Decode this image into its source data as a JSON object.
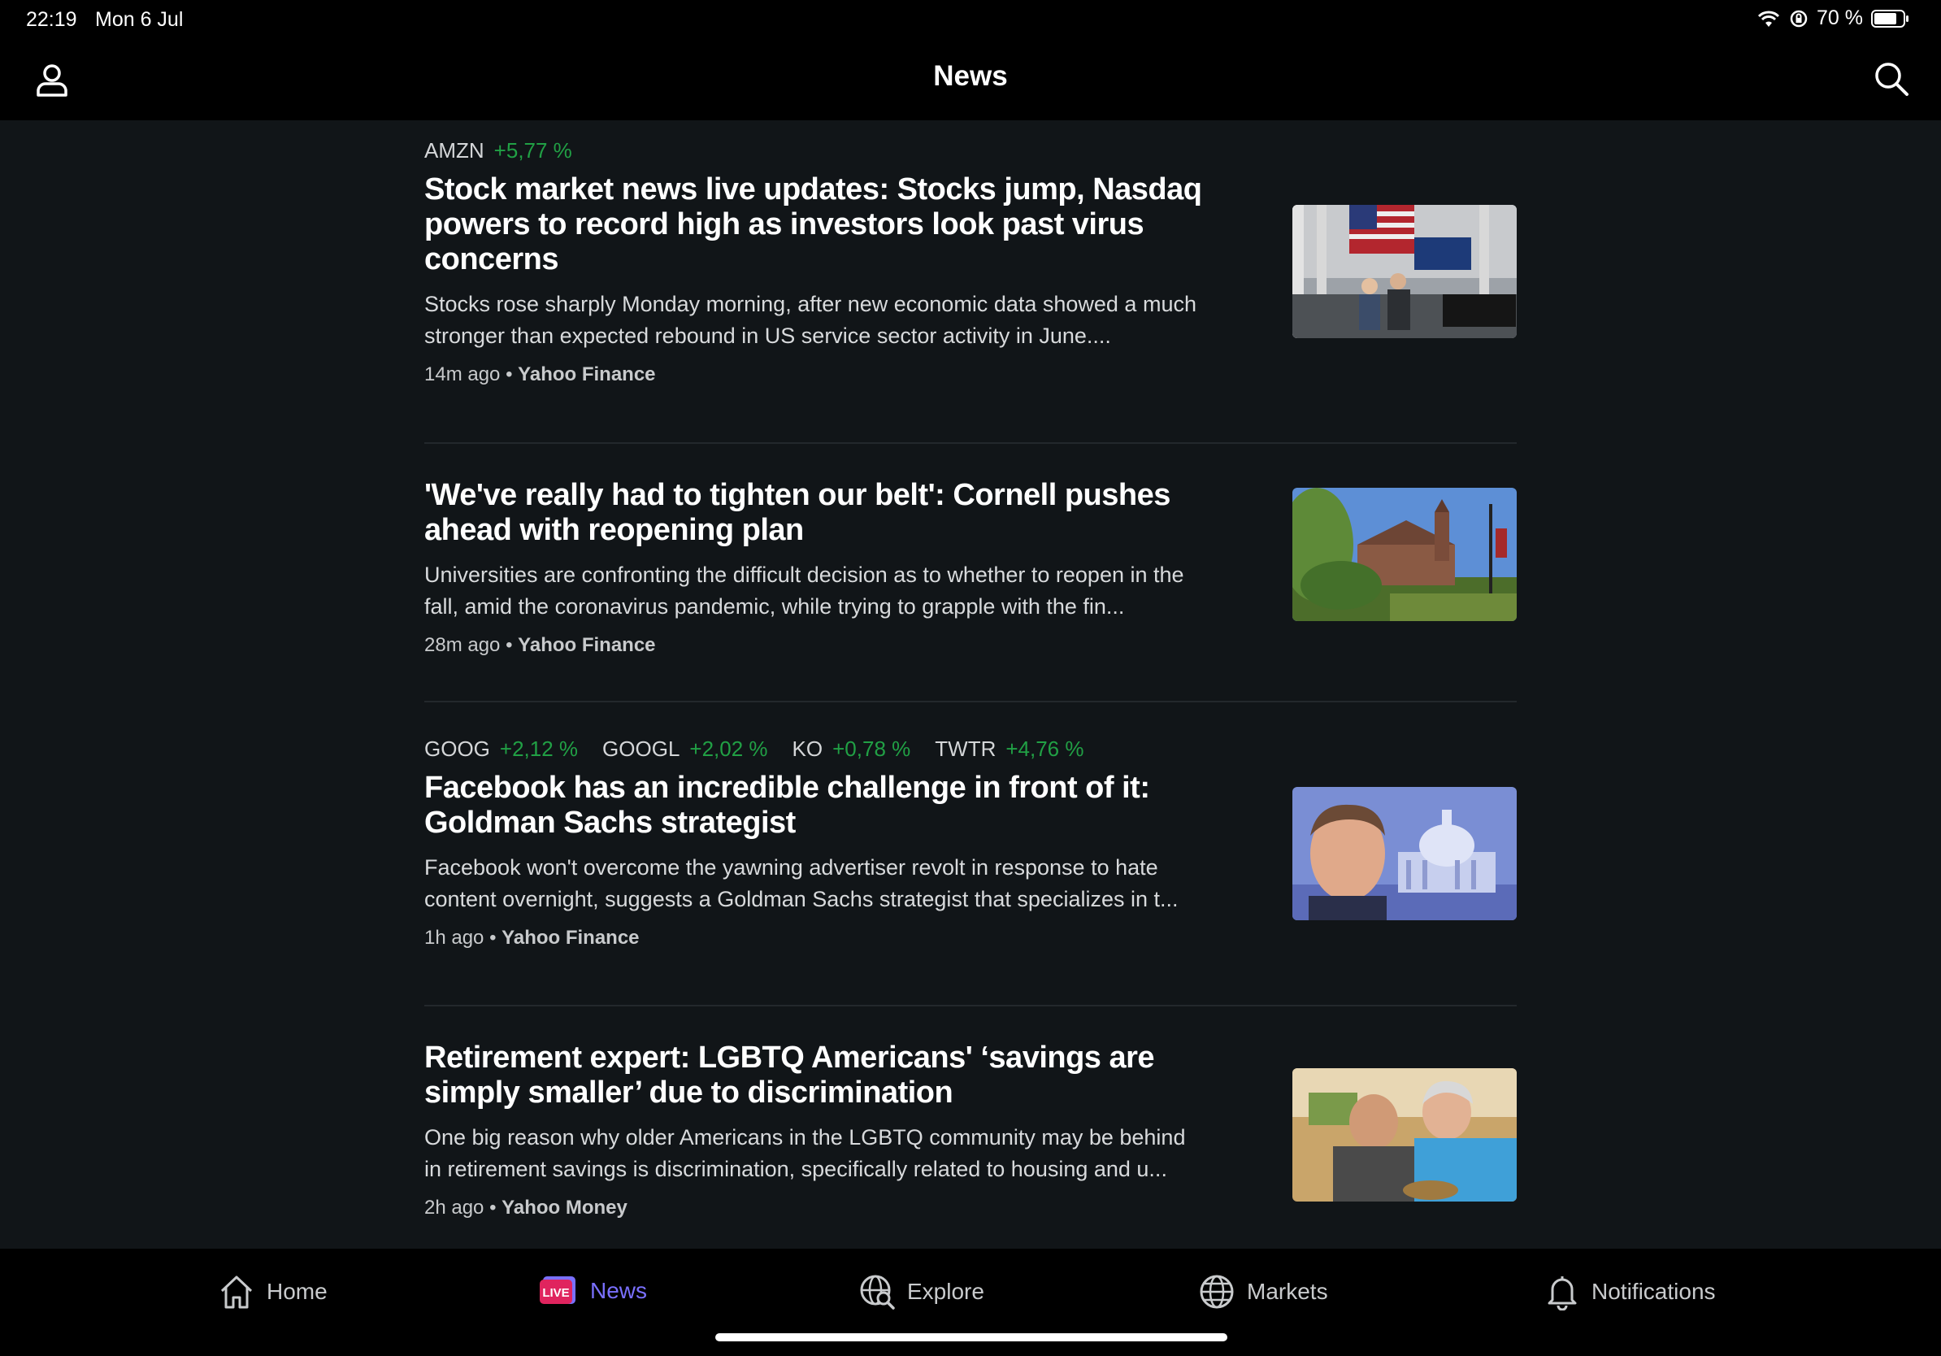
{
  "status": {
    "time": "22:19",
    "date": "Mon 6 Jul",
    "battery": "70 %"
  },
  "header": {
    "title": "News"
  },
  "articles": [
    {
      "tickers": [
        {
          "symbol": "AMZN",
          "change": "+5,77 %"
        }
      ],
      "headline": "Stock market news live updates: Stocks jump, Nasdaq powers to record high as investors look past virus concerns",
      "summary": "Stocks rose sharply Monday morning, after new economic data showed a much stronger than expected rebound in US service sector activity in June....",
      "time": "14m ago",
      "source": "Yahoo Finance"
    },
    {
      "tickers": [],
      "headline": "'We've really had to tighten our belt': Cornell pushes ahead with reopening plan",
      "summary": "Universities are confronting the difficult decision as to whether to reopen in the fall, amid the coronavirus pandemic, while trying to grapple with the fin...",
      "time": "28m ago",
      "source": "Yahoo Finance"
    },
    {
      "tickers": [
        {
          "symbol": "GOOG",
          "change": "+2,12 %"
        },
        {
          "symbol": "GOOGL",
          "change": "+2,02 %"
        },
        {
          "symbol": "KO",
          "change": "+0,78 %"
        },
        {
          "symbol": "TWTR",
          "change": "+4,76 %"
        }
      ],
      "headline": "Facebook has an incredible challenge in front of it: Goldman Sachs strategist",
      "summary": "Facebook won't overcome the yawning advertiser revolt in response to hate content overnight, suggests a Goldman Sachs strategist that specializes in t...",
      "time": "1h ago",
      "source": "Yahoo Finance"
    },
    {
      "tickers": [],
      "headline": "Retirement expert: LGBTQ Americans' ‘savings are simply smaller’ due to discrimination",
      "summary": "One big reason why older Americans in the LGBTQ community may be behind in retirement savings is discrimination, specifically related to housing and u...",
      "time": "2h ago",
      "source": "Yahoo Money"
    }
  ],
  "tabs": {
    "home": "Home",
    "live_badge": "LIVE",
    "news": "News",
    "explore": "Explore",
    "markets": "Markets",
    "notifications": "Notifications"
  },
  "colors": {
    "positive": "#21a045",
    "accent": "#7a70ff",
    "live": "#e0245e"
  }
}
